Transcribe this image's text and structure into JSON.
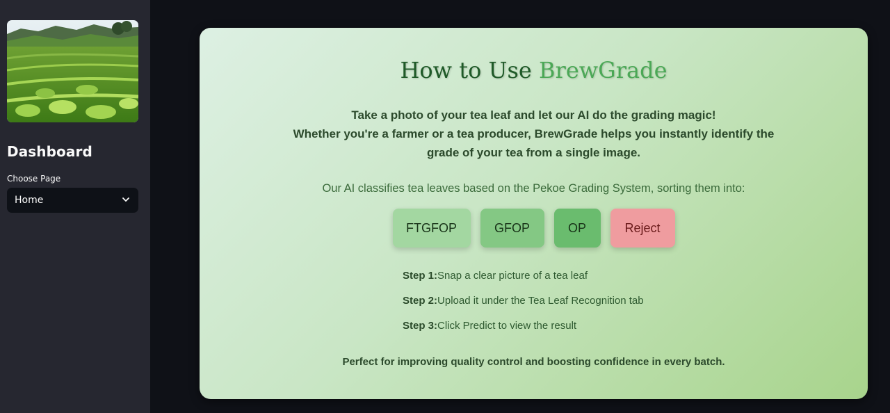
{
  "sidebar": {
    "title": "Dashboard",
    "choose_label": "Choose Page",
    "select_value": "Home"
  },
  "card": {
    "title_part1": "How to Use",
    "title_part2": "BrewGrade",
    "intro_line1": "Take a photo of your tea leaf and let our AI do the grading magic!",
    "intro_line2": "Whether you're a farmer or a tea producer, BrewGrade helps you instantly identify the",
    "intro_line3": "grade of your tea from a single image.",
    "classify_text": "Our AI classifies tea leaves based on the Pekoe Grading System, sorting them into:",
    "grades": [
      "FTGFOP",
      "GFOP",
      "OP",
      "Reject"
    ],
    "steps": [
      {
        "label": "Step 1:",
        "text": "Snap a clear picture of a tea leaf"
      },
      {
        "label": "Step 2:",
        "text": "Upload it under the Tea Leaf Recognition tab"
      },
      {
        "label": "Step 3:",
        "text": "Click Predict to view the result"
      }
    ],
    "footer": "Perfect for improving quality control and boosting confidence in every batch."
  },
  "colors": {
    "page_bg": "#0f1117",
    "sidebar_bg": "#262730",
    "title_dark": "#1f5a28",
    "title_accent": "#4ba856",
    "reject": "#ef9c9f"
  }
}
